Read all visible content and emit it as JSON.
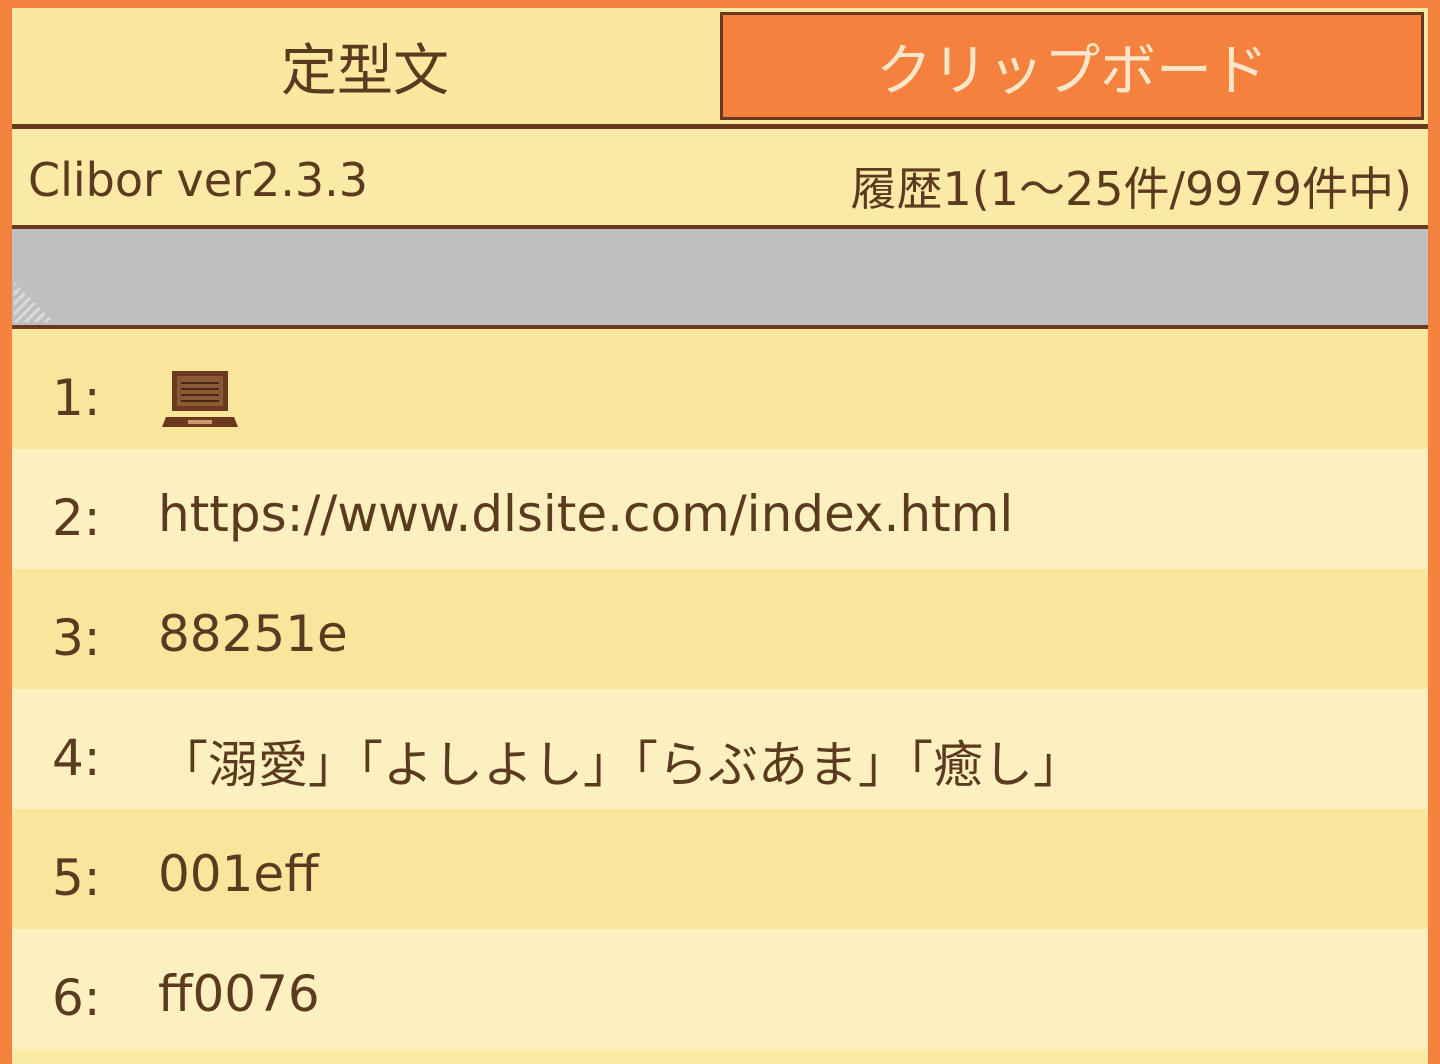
{
  "tabs": {
    "teikei_label": "定型文",
    "clipboard_label": "クリップボード"
  },
  "status": {
    "version": "Clibor ver2.3.3",
    "history_count": "履歴1(1～25件/9979件中)"
  },
  "search": {
    "value": ""
  },
  "history": [
    {
      "num": "1:",
      "text": "",
      "icon": "computer-icon"
    },
    {
      "num": "2:",
      "text": "https://www.dlsite.com/index.html"
    },
    {
      "num": "3:",
      "text": "88251e"
    },
    {
      "num": "4:",
      "text": "「溺愛」「よしよし」「らぶあま」「癒し」"
    },
    {
      "num": "5:",
      "text": "001eff"
    },
    {
      "num": "6:",
      "text": "ff0076"
    }
  ],
  "colors": {
    "frame": "#f5813f",
    "panel": "#fbe9a6",
    "active_tab": "#f5813f",
    "border": "#6b3a1e",
    "search_bg": "#bfbfbf",
    "row_odd": "#f9e59b",
    "row_even": "#fcefc0",
    "text": "#5c3a20"
  }
}
